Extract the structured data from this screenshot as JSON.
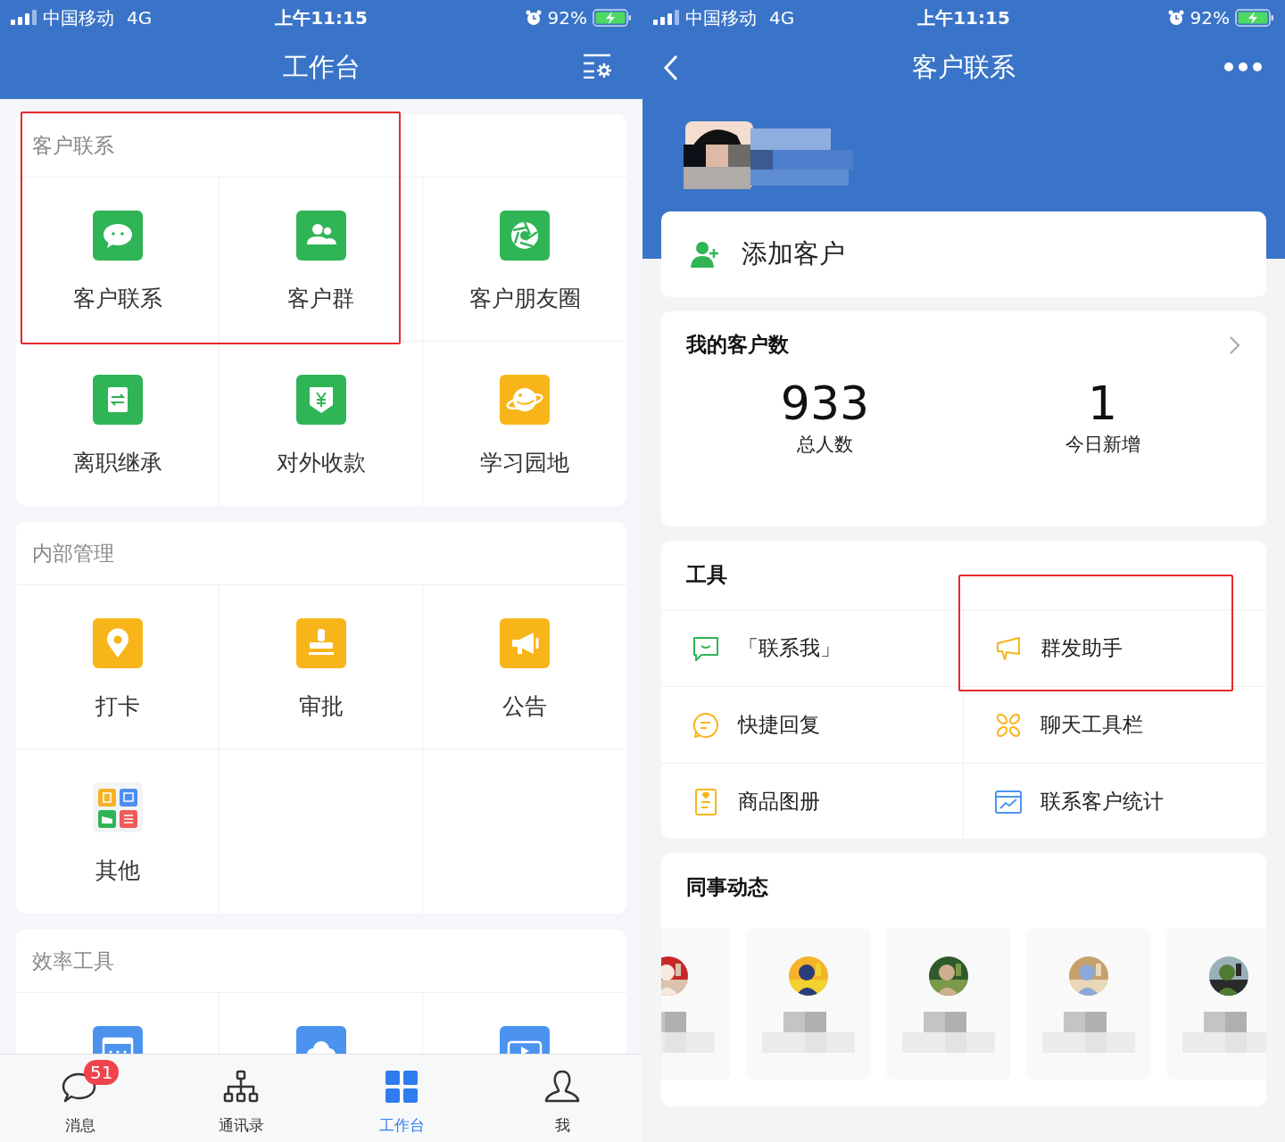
{
  "left_screen": {
    "status_bar": {
      "carrier": "中国移动",
      "network": "4G",
      "time": "上午11:15",
      "battery": "92%"
    },
    "nav": {
      "title": "工作台"
    },
    "sections": [
      {
        "title": "客户联系",
        "items": [
          {
            "kind": "chat",
            "label": "客户联系",
            "highlighted": true
          },
          {
            "kind": "group",
            "label": "客户群",
            "highlighted": true
          },
          {
            "kind": "aperture",
            "label": "客户朋友圈",
            "highlighted": false
          },
          {
            "kind": "transfer",
            "label": "离职继承",
            "highlighted": false
          },
          {
            "kind": "yen",
            "label": "对外收款",
            "highlighted": false
          },
          {
            "kind": "planet",
            "label": "学习园地",
            "highlighted": false
          }
        ]
      },
      {
        "title": "内部管理",
        "items": [
          {
            "kind": "pin",
            "label": "打卡",
            "highlighted": false
          },
          {
            "kind": "stamp",
            "label": "审批",
            "highlighted": false
          },
          {
            "kind": "megaphone",
            "label": "公告",
            "highlighted": false
          },
          {
            "kind": "apps",
            "label": "其他",
            "highlighted": false
          }
        ]
      },
      {
        "title": "效率工具",
        "items": [
          {
            "kind": "calendar",
            "highlighted": false
          },
          {
            "kind": "cloud",
            "highlighted": false
          },
          {
            "kind": "live",
            "highlighted": false
          }
        ]
      }
    ],
    "tab_bar": [
      {
        "kind": "chat",
        "label": "消息",
        "badge": "51",
        "selected": false
      },
      {
        "kind": "org",
        "label": "通讯录",
        "selected": false
      },
      {
        "kind": "grid",
        "label": "工作台",
        "selected": true
      },
      {
        "kind": "person",
        "label": "我",
        "selected": false
      }
    ]
  },
  "right_screen": {
    "status_bar": {
      "carrier": "中国移动",
      "network": "4G",
      "time": "上午11:15",
      "battery": "92%"
    },
    "nav": {
      "title": "客户联系"
    },
    "add_customer": {
      "label": "添加客户"
    },
    "customer_count": {
      "title": "我的客户数",
      "stats": [
        {
          "value": "933",
          "label": "总人数"
        },
        {
          "value": "1",
          "label": "今日新增"
        }
      ]
    },
    "tools": {
      "title": "工具",
      "items": [
        {
          "kind": "contact",
          "label": "「联系我」",
          "highlighted": false
        },
        {
          "kind": "broadcast",
          "label": "群发助手",
          "highlighted": true
        },
        {
          "kind": "reply",
          "label": "快捷回复",
          "highlighted": false
        },
        {
          "kind": "toolbar",
          "label": "聊天工具栏",
          "highlighted": false
        },
        {
          "kind": "catalog",
          "label": "商品图册",
          "highlighted": false
        },
        {
          "kind": "stats",
          "label": "联系客户统计",
          "highlighted": false
        }
      ]
    },
    "colleague_feed": {
      "title": "同事动态"
    }
  }
}
